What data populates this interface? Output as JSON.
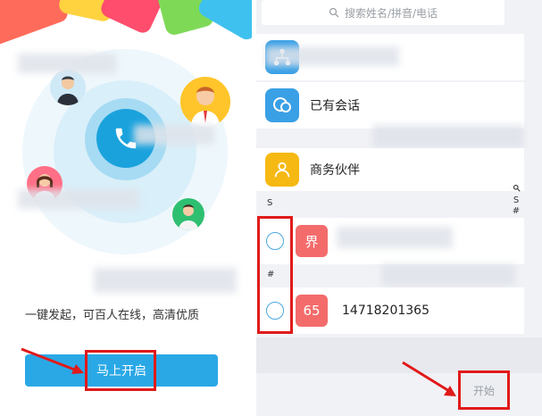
{
  "left": {
    "description": "一键发起，可百人在线，高清优质",
    "cta_label": "马上开启"
  },
  "right": {
    "search_placeholder": "搜索姓名/拼音/电话",
    "rows": [
      {
        "label": ""
      },
      {
        "label": "已有会话"
      },
      {
        "label": "商务伙伴"
      }
    ],
    "section_s": "S",
    "section_hash": "#",
    "contacts": [
      {
        "badge": "界",
        "name": ""
      },
      {
        "badge": "65",
        "name": "14718201365"
      }
    ],
    "index_bar": [
      "S",
      "#"
    ],
    "start_label": "开始"
  },
  "colors": {
    "accent_blue": "#2aa8e6",
    "annotation_red": "#e01a1a",
    "badge_red": "#f46b6b",
    "partner_yellow": "#f6b913"
  }
}
